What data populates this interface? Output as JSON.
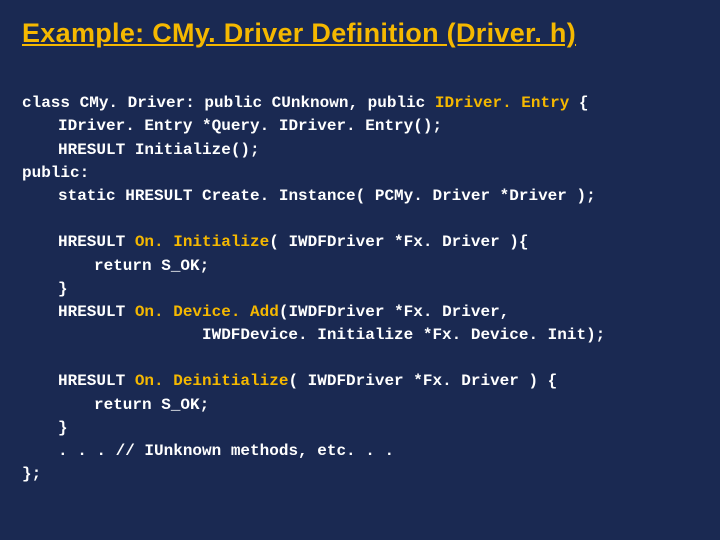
{
  "slide": {
    "title": "Example: CMy. Driver Definition (Driver. h)",
    "code": {
      "l1_a": "class CMy. Driver: public CUnknown, public ",
      "l1_b": "IDriver. Entry",
      "l1_c": " {",
      "l2": "IDriver. Entry *Query. IDriver. Entry();",
      "l3": "HRESULT Initialize();",
      "l4": "public:",
      "l5": "static HRESULT Create. Instance( PCMy. Driver *Driver );",
      "l6_a": "HRESULT ",
      "l6_b": "On. Initialize",
      "l6_c": "( IWDFDriver *Fx. Driver ){",
      "l7": "return S_OK;",
      "l8": "}",
      "l9_a": "HRESULT ",
      "l9_b": "On. Device. Add",
      "l9_c": "(IWDFDriver *Fx. Driver,",
      "l10": "IWDFDevice. Initialize *Fx. Device. Init);",
      "l11_a": "HRESULT ",
      "l11_b": "On. Deinitialize",
      "l11_c": "( IWDFDriver *Fx. Driver ) {",
      "l12": "return S_OK;",
      "l13": "}",
      "l14": ". . . // IUnknown methods, etc. . .",
      "l15": "};"
    }
  }
}
